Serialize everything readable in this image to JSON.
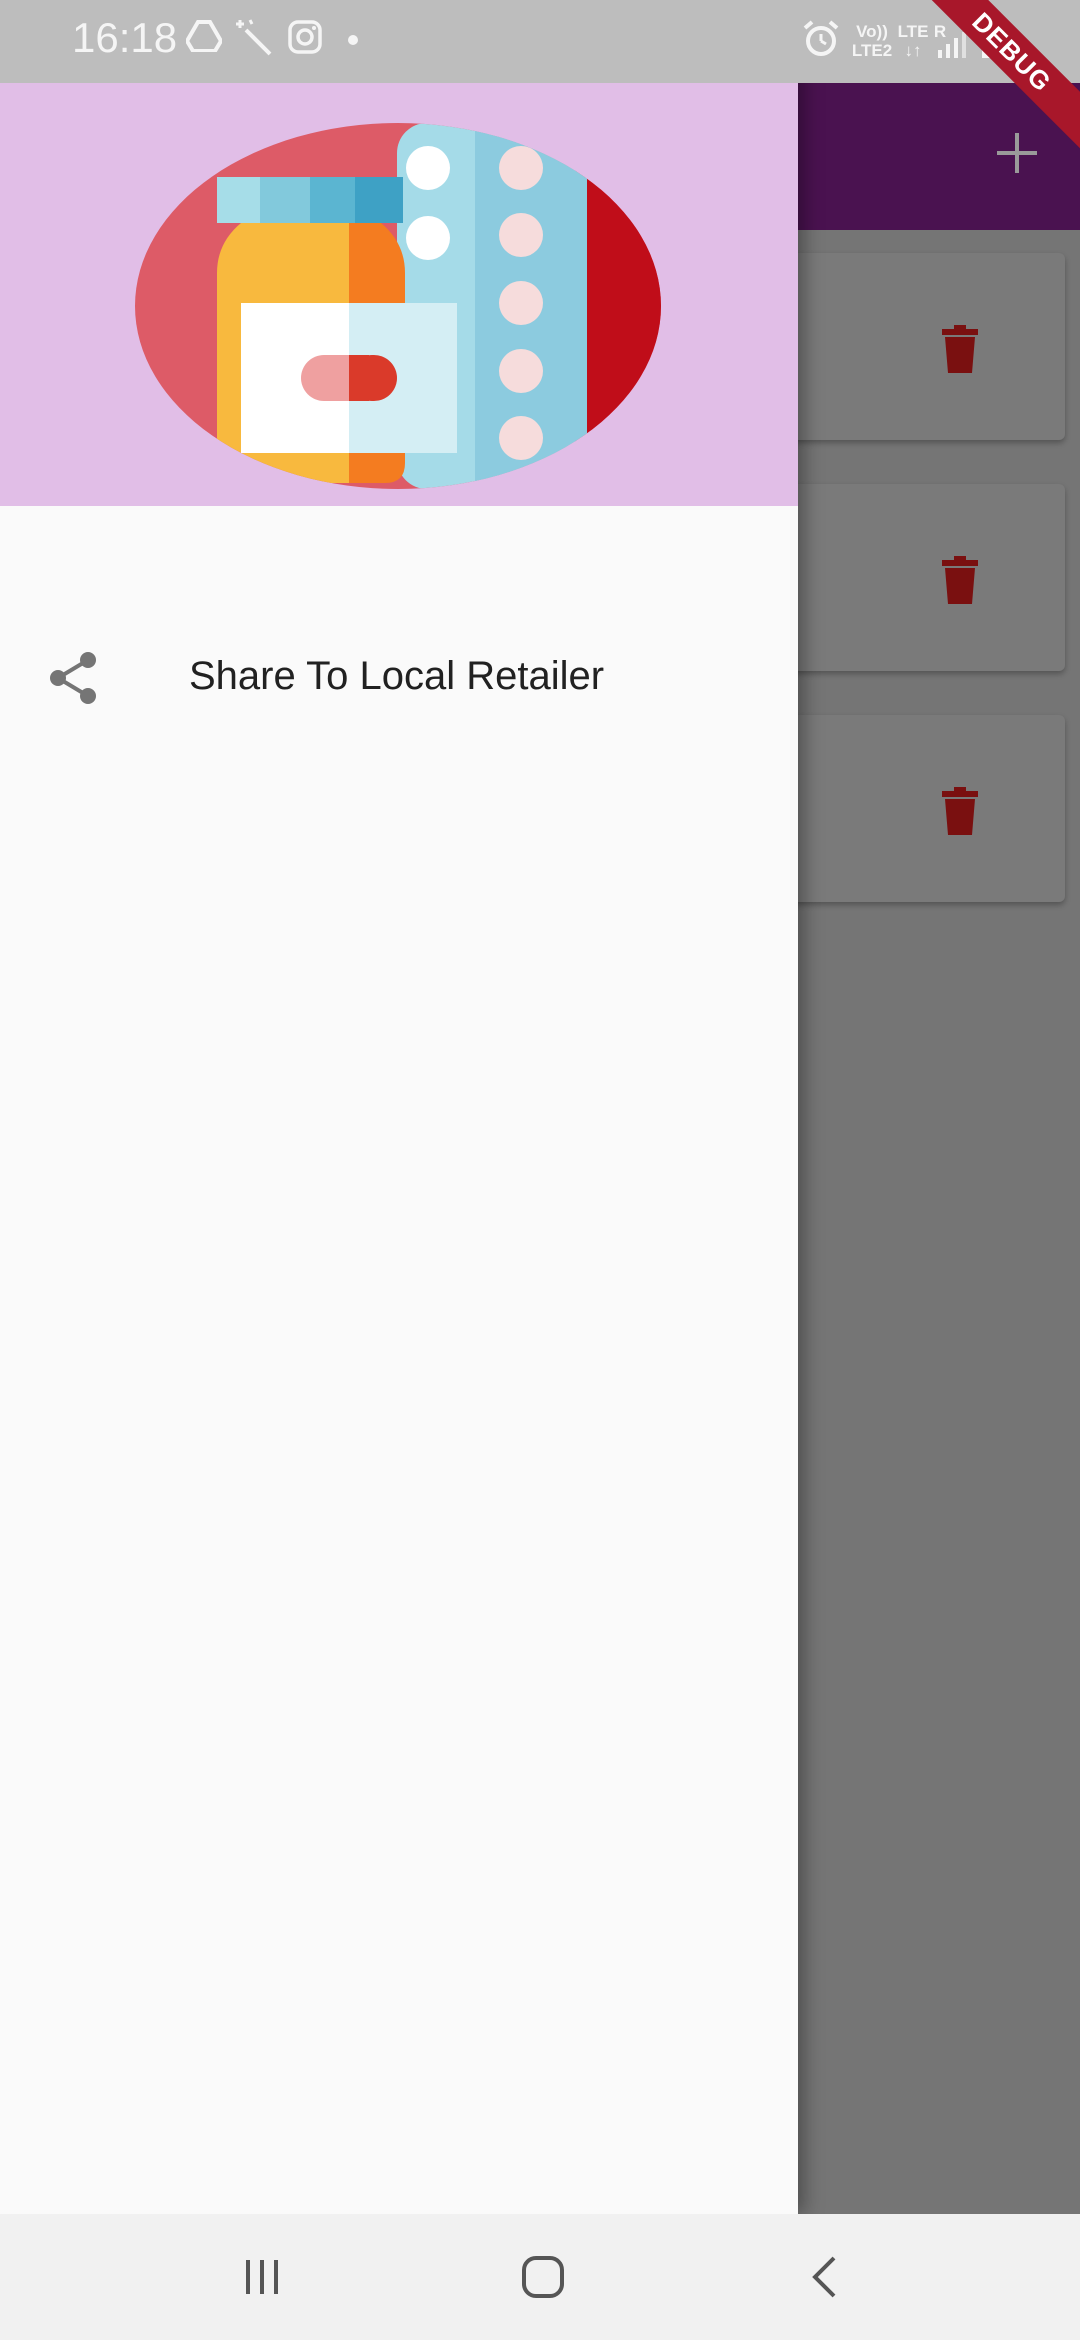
{
  "status_bar": {
    "time": "16:18",
    "notification_icons": [
      "drive-icon",
      "magic-wand-icon",
      "instagram-icon",
      "dot-icon"
    ],
    "system_icons": [
      "alarm-icon",
      "volte-icon",
      "lte-icon",
      "signal-icon",
      "battery-icon"
    ],
    "volte_label_top": "Vo))",
    "volte_label_bottom": "LTE2",
    "lte_label": "LTE",
    "roaming_label": "R"
  },
  "debug_banner": "DEBUG",
  "app_bar": {
    "add_icon": "plus-icon",
    "background_color": "#4a1250"
  },
  "cards": [
    {
      "delete_icon": "trash-icon"
    },
    {
      "delete_icon": "trash-icon"
    },
    {
      "delete_icon": "trash-icon"
    }
  ],
  "drawer": {
    "header_color": "#e1bee7",
    "header_image": "medicine-bottle-and-pills-illustration",
    "items": [
      {
        "icon": "share-icon",
        "label": "Share To Local Retailer"
      }
    ]
  },
  "nav_bar": {
    "buttons": [
      "recent-apps-icon",
      "home-icon",
      "back-icon"
    ]
  }
}
